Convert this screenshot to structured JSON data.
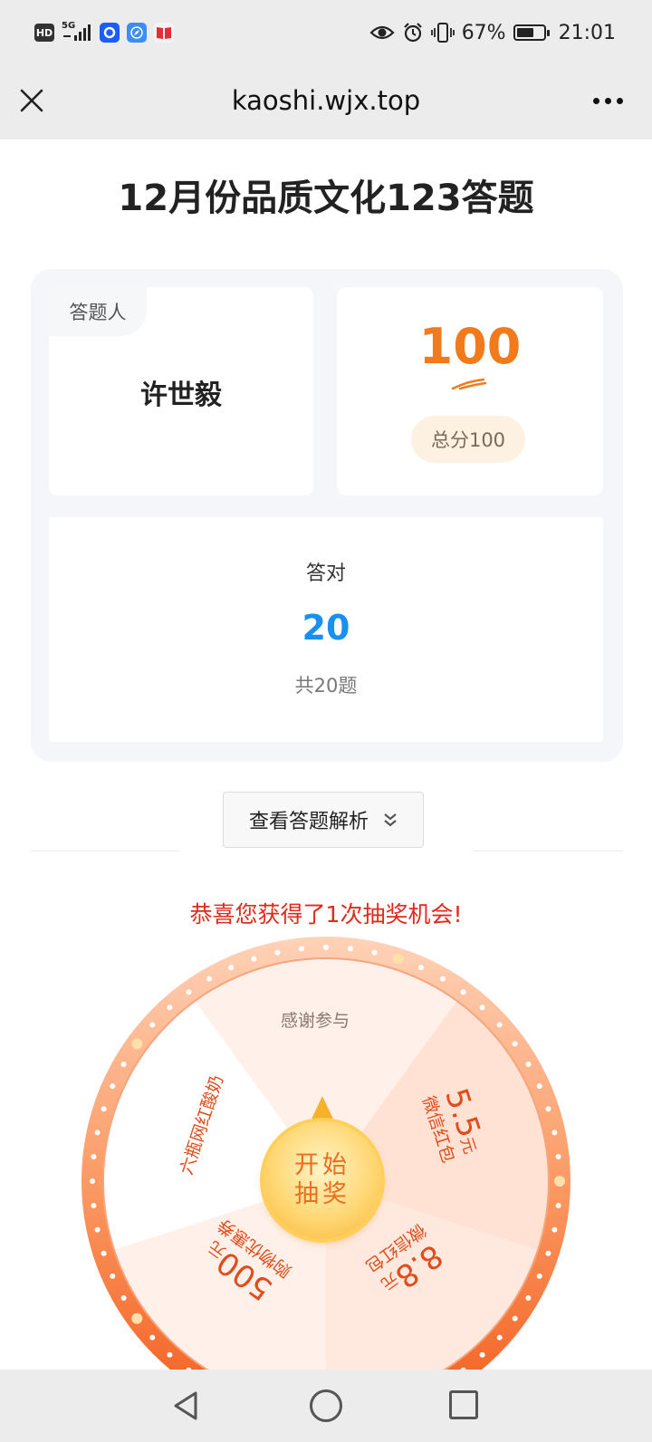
{
  "status_bar": {
    "hd_label": "HD",
    "network_label": "5G",
    "battery_percent": "67%",
    "battery_level": 0.67,
    "time": "21:01",
    "icons": [
      "hd-icon",
      "signal-icon",
      "app-icon-blue-circle",
      "app-icon-compass",
      "app-icon-book",
      "eye-icon",
      "alarm-icon",
      "vibrate-icon",
      "battery-icon"
    ]
  },
  "browser": {
    "url_title": "kaoshi.wjx.top",
    "close_icon": "close-icon",
    "more_icon": "more-icon"
  },
  "quiz": {
    "title": "12月份品质文化123答题",
    "respondent_label": "答题人",
    "respondent_name": "许世毅",
    "score": "100",
    "total_score_label": "总分100",
    "correct_label": "答对",
    "correct_count": "20",
    "total_questions_label": "共20题",
    "analysis_button_label": "查看答题解析"
  },
  "lottery": {
    "message": "恭喜您获得了1次抽奖机会!",
    "start_button_line1": "开始",
    "start_button_line2": "抽奖",
    "prizes": {
      "top": "感谢参与",
      "right_amount": "5.5",
      "right_unit": "元",
      "right_desc": "微信红包",
      "bottom_right_amount": "8.8",
      "bottom_right_unit": "元",
      "bottom_right_desc": "微信红包",
      "bottom_left_amount": "500",
      "bottom_left_unit": "元",
      "bottom_left_desc": "购物优惠券",
      "left": "六瓶网红酸奶"
    },
    "colors": {
      "ring": "#f97a3d",
      "segment_light": "#fff1ea",
      "segment_white": "#ffffff",
      "prize_text": "#e04c1b",
      "button": "#ffd773"
    }
  },
  "system_nav": {
    "icons": [
      "back-icon",
      "home-icon",
      "recent-apps-icon"
    ]
  }
}
